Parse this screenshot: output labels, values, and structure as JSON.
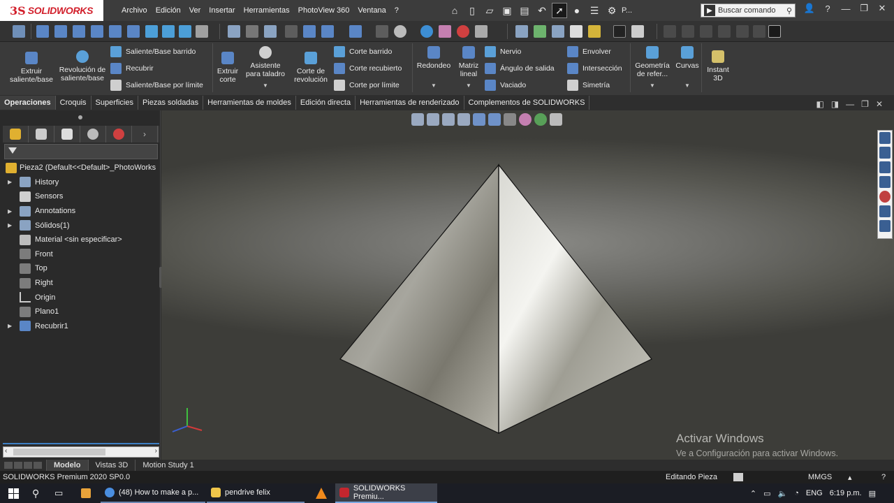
{
  "app": {
    "logo_prefix": "3S",
    "logo_text": "SOLIDWORKS"
  },
  "menu": [
    "Archivo",
    "Edición",
    "Ver",
    "Insertar",
    "Herramientas",
    "PhotoView 360",
    "Ventana",
    "?"
  ],
  "quick_access": {
    "overflow_label": "P..."
  },
  "search": {
    "placeholder": "Buscar comando"
  },
  "ribbon": {
    "extrude": "Extruir saliente/base",
    "revolve": "Revolución de saliente/base",
    "sweep": "Saliente/Base barrido",
    "loft": "Recubrir",
    "boundary": "Saliente/Base por límite",
    "extrude_cut": "Extruir corte",
    "hole_wizard": "Asistente para taladro",
    "revolve_cut": "Corte de revolución",
    "swept_cut": "Corte barrido",
    "lofted_cut": "Corte recubierto",
    "boundary_cut": "Corte por límite",
    "fillet": "Redondeo",
    "linear_pattern": "Matriz lineal",
    "rib": "Nervio",
    "draft": "Ángulo de salida",
    "shell": "Vaciado",
    "wrap": "Envolver",
    "intersect": "Intersección",
    "mirror": "Simetría",
    "ref_geometry": "Geometría de refer...",
    "curves": "Curvas",
    "instant3d": "Instant 3D"
  },
  "tabs": [
    "Operaciones",
    "Croquis",
    "Superficies",
    "Piezas soldadas",
    "Herramientas de moldes",
    "Edición directa",
    "Herramientas de renderizado",
    "Complementos de SOLIDWORKS"
  ],
  "tree": {
    "root": "Pieza2  (Default<<Default>_PhotoWorks",
    "items": [
      "History",
      "Sensors",
      "Annotations",
      "Sólidos(1)",
      "Material <sin especificar>",
      "Front",
      "Top",
      "Right",
      "Origin",
      "Plano1",
      "Recubrir1"
    ]
  },
  "watermark": {
    "line1": "Activar Windows",
    "line2": "Ve a Configuración para activar Windows."
  },
  "bottom_tabs": [
    "Modelo",
    "Vistas 3D",
    "Motion Study 1"
  ],
  "status": {
    "left": "SOLIDWORKS Premium 2020 SP0.0",
    "mode": "Editando Pieza",
    "units": "MMGS"
  },
  "taskbar": {
    "items": [
      "(48) How to make a p...",
      "pendrive felix",
      "SOLIDWORKS Premiu..."
    ],
    "lang": "ENG",
    "time": "6:19 p.m."
  },
  "colors": {
    "accent_blue": "#3d7fc4",
    "brand_red": "#d21f2b"
  }
}
